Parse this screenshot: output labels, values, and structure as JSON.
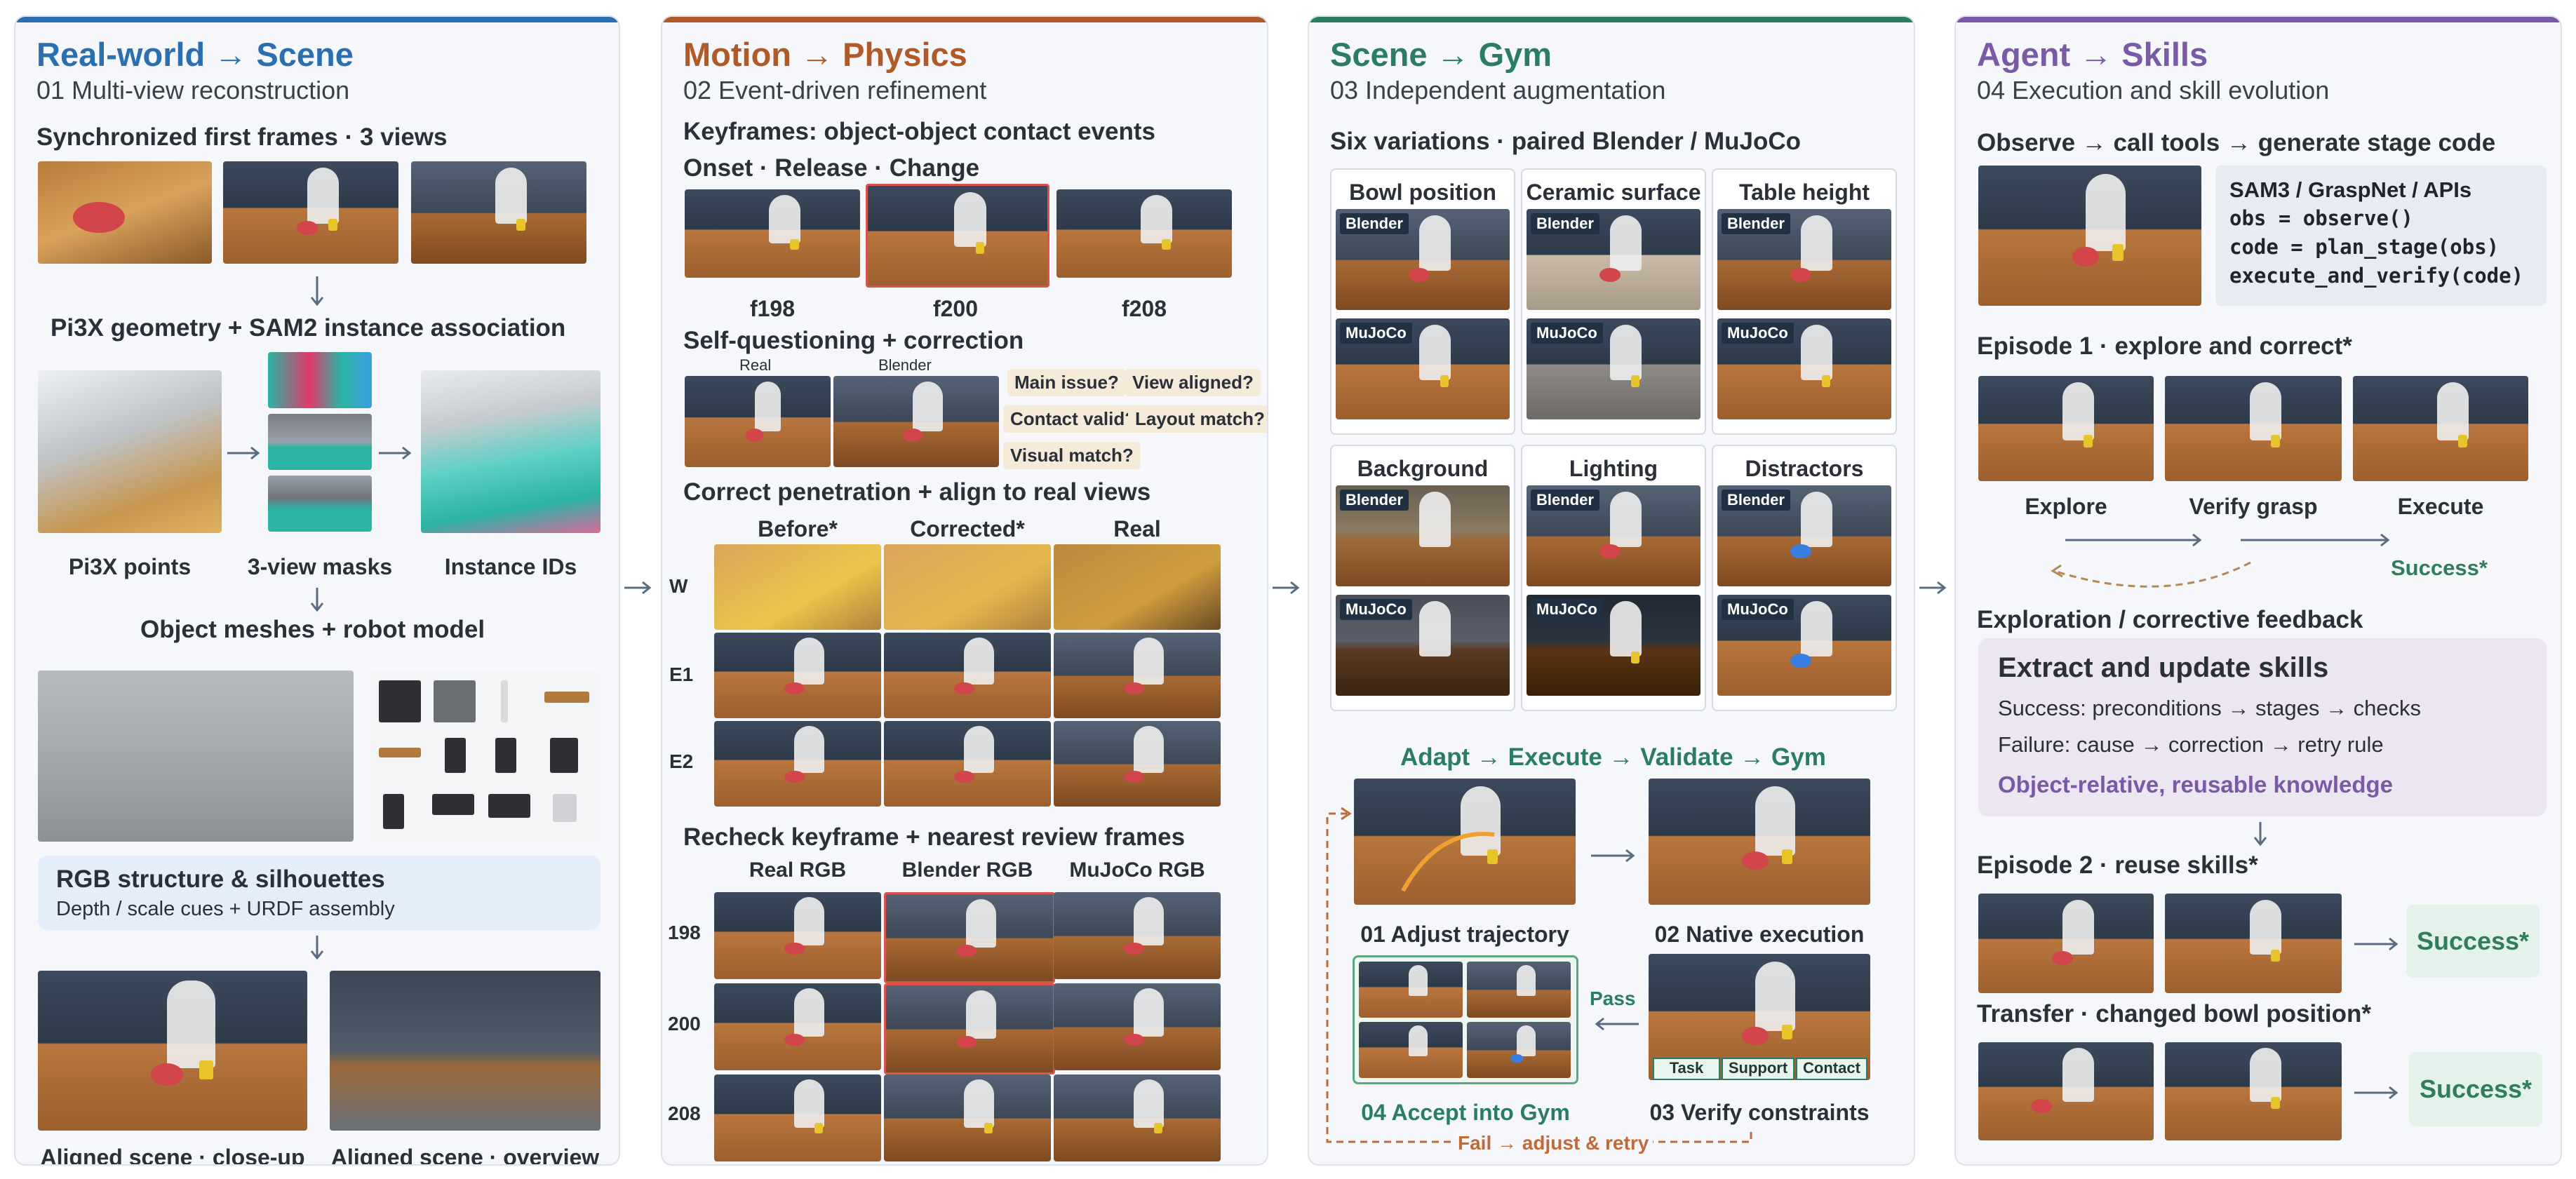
{
  "colors": {
    "blue": "#2a6fb0",
    "orange": "#b05a2a",
    "green": "#2a7d62",
    "purple": "#7a5aa6",
    "arrow": "#5a6c82",
    "fail": "#c06a3a"
  },
  "p1": {
    "title_a": "Real-world",
    "arrow": "→",
    "title_b": "Scene",
    "subtitle": "01  Multi-view reconstruction",
    "h_frames": "Synchronized first frames · 3 views",
    "h_geom": "Pi3X geometry + SAM2 instance association",
    "lbl_points": "Pi3X points",
    "lbl_masks": "3-view masks",
    "lbl_ids": "Instance IDs",
    "h_meshes": "Object meshes + robot model",
    "box_title": "RGB structure & silhouettes",
    "box_text": "Depth / scale cues + URDF assembly",
    "lbl_close": "Aligned scene · close-up",
    "lbl_over": "Aligned scene · overview"
  },
  "p2": {
    "title_a": "Motion",
    "arrow": "→",
    "title_b": "Physics",
    "subtitle": "02  Event-driven refinement",
    "h_key": "Keyframes: object-object contact events",
    "h_onset": "Onset · Release · Change",
    "frames": [
      "f198",
      "f200",
      "f208"
    ],
    "h_self": "Self-questioning + correction",
    "lbl_real": "Real",
    "lbl_blender": "Blender",
    "chips": [
      "Main issue?",
      "View aligned?",
      "Contact valid?",
      "Layout match?",
      "Visual match?"
    ],
    "h_pen": "Correct penetration + align to real views",
    "cols1": [
      "Before*",
      "Corrected*",
      "Real"
    ],
    "rows1": [
      "W",
      "E1",
      "E2"
    ],
    "h_recheck": "Recheck keyframe + nearest review frames",
    "cols2": [
      "Real RGB",
      "Blender RGB",
      "MuJoCo RGB"
    ],
    "rows2": [
      "198",
      "200",
      "208"
    ]
  },
  "p3": {
    "title_a": "Scene",
    "arrow": "→",
    "title_b": "Gym",
    "subtitle": "03  Independent augmentation",
    "h_six": "Six variations · paired Blender / MuJoCo",
    "variations": [
      "Bowl position",
      "Ceramic surface",
      "Table height",
      "Background",
      "Lighting",
      "Distractors"
    ],
    "tag_blender": "Blender",
    "tag_mujoco": "MuJoCo",
    "h_loop": "Adapt → Execute → Validate → Gym",
    "step1": "01  Adjust trajectory",
    "step2": "02  Native execution",
    "step3": "03  Verify constraints",
    "step4": "04  Accept into Gym",
    "pass": "Pass",
    "fail": "Fail → adjust & retry",
    "checks": [
      "Task",
      "Support",
      "Contact"
    ]
  },
  "p4": {
    "title_a": "Agent",
    "arrow": "→",
    "title_b": "Skills",
    "subtitle": "04  Execution and skill evolution",
    "h_obs": "Observe → call tools → generate stage code",
    "code_title": "SAM3 / GraspNet / APIs",
    "code_lines": [
      "obs = observe()",
      "code = plan_stage(obs)",
      "execute_and_verify(code)"
    ],
    "h_ep1": "Episode 1 · explore and correct*",
    "steps": [
      "Explore",
      "Verify grasp",
      "Execute"
    ],
    "success_star": "Success*",
    "h_feedback": "Exploration / corrective feedback",
    "skill_title": "Extract and update skills",
    "skill_l1": "Success: preconditions → stages → checks",
    "skill_l2": "Failure: cause → correction → retry rule",
    "skill_l3": "Object-relative, reusable knowledge",
    "h_ep2": "Episode 2 · reuse skills*",
    "h_transfer": "Transfer · changed bowl position*"
  }
}
